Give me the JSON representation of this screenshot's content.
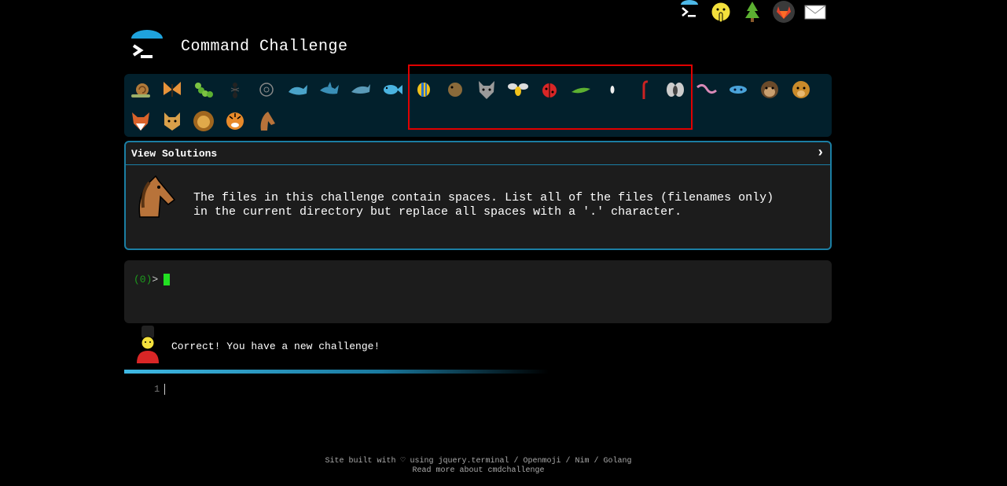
{
  "header": {
    "title": "Command Challenge"
  },
  "top_icons": [
    "terminal-icon",
    "shushing-face-icon",
    "tree-icon",
    "gitlab-icon",
    "envelope-icon"
  ],
  "animals": [
    "snail",
    "butterfly",
    "caterpillar",
    "ant",
    "sand-dollar",
    "whale",
    "shark",
    "dolphin",
    "fish",
    "tropical-fish",
    "blowfish",
    "wolf",
    "bee",
    "ladybug",
    "pea-pod",
    "bug",
    "scorpion",
    "fly",
    "worm",
    "microbe",
    "monkey",
    "dog",
    "fox",
    "cat",
    "lion",
    "tiger",
    "horse"
  ],
  "panel": {
    "title": "View Solutions",
    "chevron": "›",
    "challenge_line1": "The files in this challenge contain spaces. List all of the files (filenames only)",
    "challenge_line2": "in the current directory but replace all spaces with a '.' character."
  },
  "terminal": {
    "prompt_code": "(0)",
    "prompt_symbol": ">"
  },
  "message": "Correct! You have a new challenge!",
  "editor": {
    "line_number": "1"
  },
  "footer": {
    "line1": "Site built with ♡ using jquery.terminal / Openmoji / Nim / Golang",
    "line2": "Read more about cmdchallenge"
  },
  "colors": {
    "accent": "#1b7ea3",
    "bar_bg": "#02202c",
    "highlight": "#e00000",
    "prompt": "#22e022"
  }
}
